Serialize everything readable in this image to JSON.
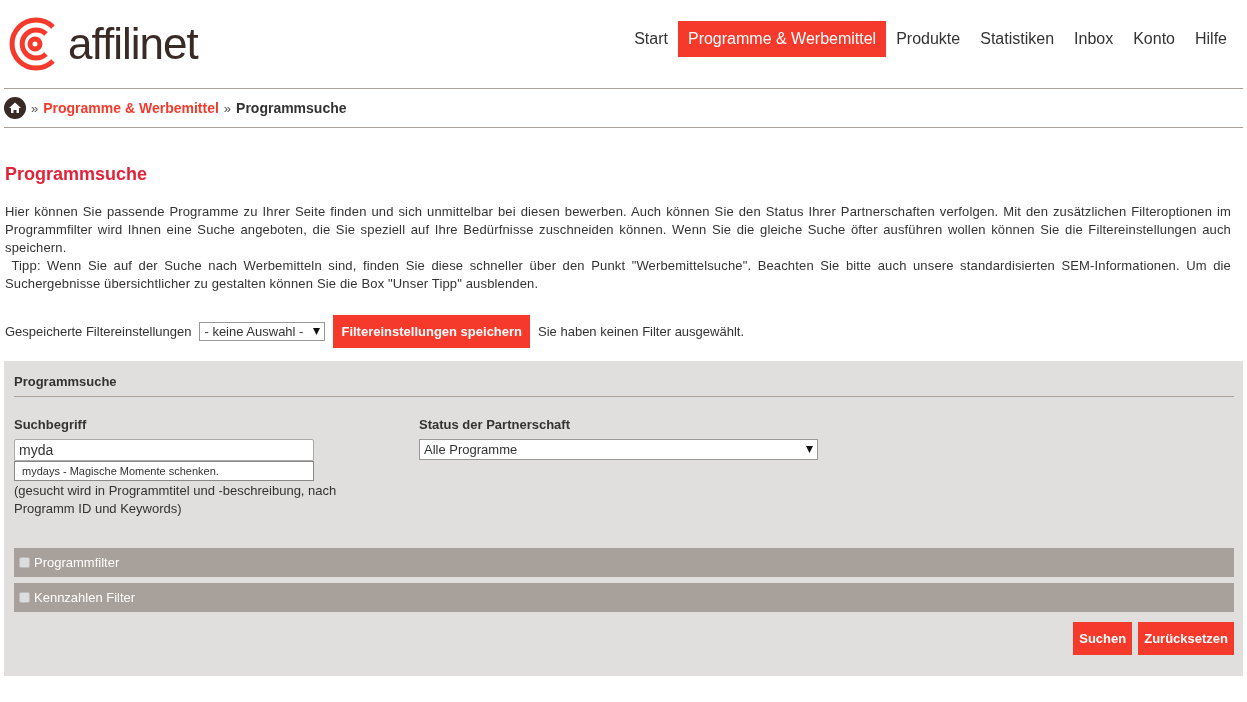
{
  "header": {
    "logo": "affilinet"
  },
  "nav": [
    {
      "label": "Start",
      "selected": false
    },
    {
      "label": "Programme & Werbemittel",
      "selected": true
    },
    {
      "label": "Produkte",
      "selected": false
    },
    {
      "label": "Statistiken",
      "selected": false
    },
    {
      "label": "Inbox",
      "selected": false
    },
    {
      "label": "Konto",
      "selected": false
    },
    {
      "label": "Hilfe",
      "selected": false
    }
  ],
  "breadcrumb": [
    {
      "label": "Programme & Werbemittel",
      "kind": "link"
    },
    {
      "label": "Programmsuche",
      "kind": "current"
    }
  ],
  "breadcrumb_separator": "»",
  "page_title": "Programmsuche",
  "intro": [
    "Hier können Sie passende Programme zu Ihrer Seite finden und sich unmittelbar bei diesen bewerben. Auch können Sie den Status Ihrer Partnerschaften verfolgen. Mit den zusätzlichen Filteroptionen im Programmfilter wird Ihnen eine Suche angeboten, die Sie speziell auf Ihre Bedürfnisse zuschneiden können. Wenn Sie die gleiche Suche öfter ausführen wollen können Sie die Filtereinstellungen auch speichern.",
    " Tipp: Wenn Sie auf der Suche nach Werbemitteln sind, finden Sie diese schneller über den Punkt \"Werbemittelsuche\". Beachten Sie bitte auch unsere standardisierten SEM-Informationen. Um die Suchergebnisse übersichtlicher zu gestalten können Sie die Box \"Unser Tipp\" ausblenden."
  ],
  "saved_filters": {
    "label": "Gespeicherte Filtereinstellungen",
    "value": "- keine Auswahl -",
    "button": "Filtereinstellungen speichern",
    "status": "Sie haben keinen Filter ausgewählt."
  },
  "panel": {
    "title": "Programmsuche",
    "search": {
      "label": "Suchbegriff",
      "value": "myda",
      "suggestion": "mydays - Magische Momente schenken.",
      "hint": "(gesucht wird in Programmtitel und -beschreibung, nach Programm ID und Keywords)"
    },
    "status": {
      "label": "Status der Partnerschaft",
      "value": "Alle Programme"
    },
    "sections": [
      {
        "label": "Programmfilter",
        "expanded": false
      },
      {
        "label": "Kennzahlen Filter",
        "expanded": false
      }
    ],
    "buttons": [
      "Suchen",
      "Zurücksetzen"
    ]
  }
}
